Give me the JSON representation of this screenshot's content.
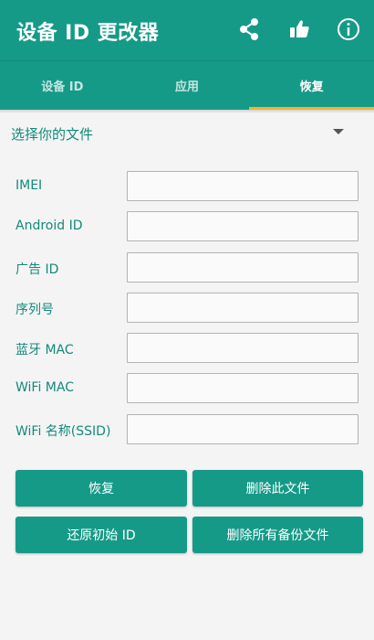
{
  "app": {
    "title": "设备 ID 更改器",
    "accent_color": "#169a88",
    "indicator_color": "#f5b32a",
    "icons": [
      "share-icon",
      "thumbs-up-icon",
      "info-icon"
    ]
  },
  "tabs": [
    {
      "label": "设备 ID",
      "active": false
    },
    {
      "label": "应用",
      "active": false
    },
    {
      "label": "恢复",
      "active": true
    }
  ],
  "file_select": {
    "label": "选择你的文件"
  },
  "fields": [
    {
      "label": "IMEI",
      "value": ""
    },
    {
      "label": "Android ID",
      "value": ""
    },
    {
      "label": "广告 ID",
      "value": ""
    },
    {
      "label": "序列号",
      "value": ""
    },
    {
      "label": "蓝牙 MAC",
      "value": ""
    },
    {
      "label": "WiFi MAC",
      "value": ""
    },
    {
      "label": "WiFi 名称(SSID)",
      "value": ""
    }
  ],
  "buttons": {
    "restore": "恢复",
    "delete_file": "删除此文件",
    "restore_original": "还原初始 ID",
    "delete_all_backups": "删除所有备份文件"
  }
}
